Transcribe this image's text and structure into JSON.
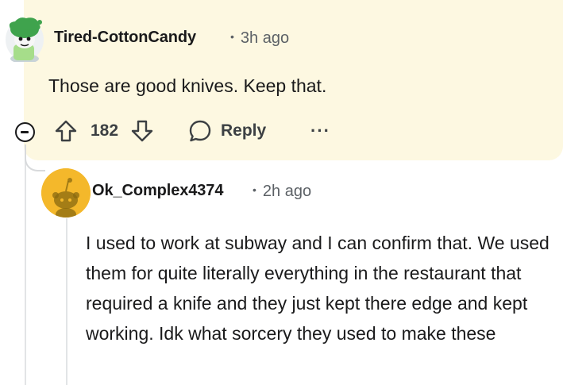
{
  "comment": {
    "author": "Tired-CottonCandy",
    "dot": "•",
    "time": "3h ago",
    "body": "Those are good knives. Keep that.",
    "score": "182",
    "reply_label": "Reply",
    "more_label": "···"
  },
  "reply": {
    "author": "Ok_Complex4374",
    "dot": "•",
    "time": "2h ago",
    "body": "I used to work at subway and I can confirm that. We used them for quite literally everything in the restaurant that required a knife and they just kept there edge and kept working. Idk what sorcery they used to make these"
  },
  "colors": {
    "highlight": "#fdf8e1",
    "avatar_yellow": "#f4b82b",
    "avatar_green": "#3fa34d"
  }
}
